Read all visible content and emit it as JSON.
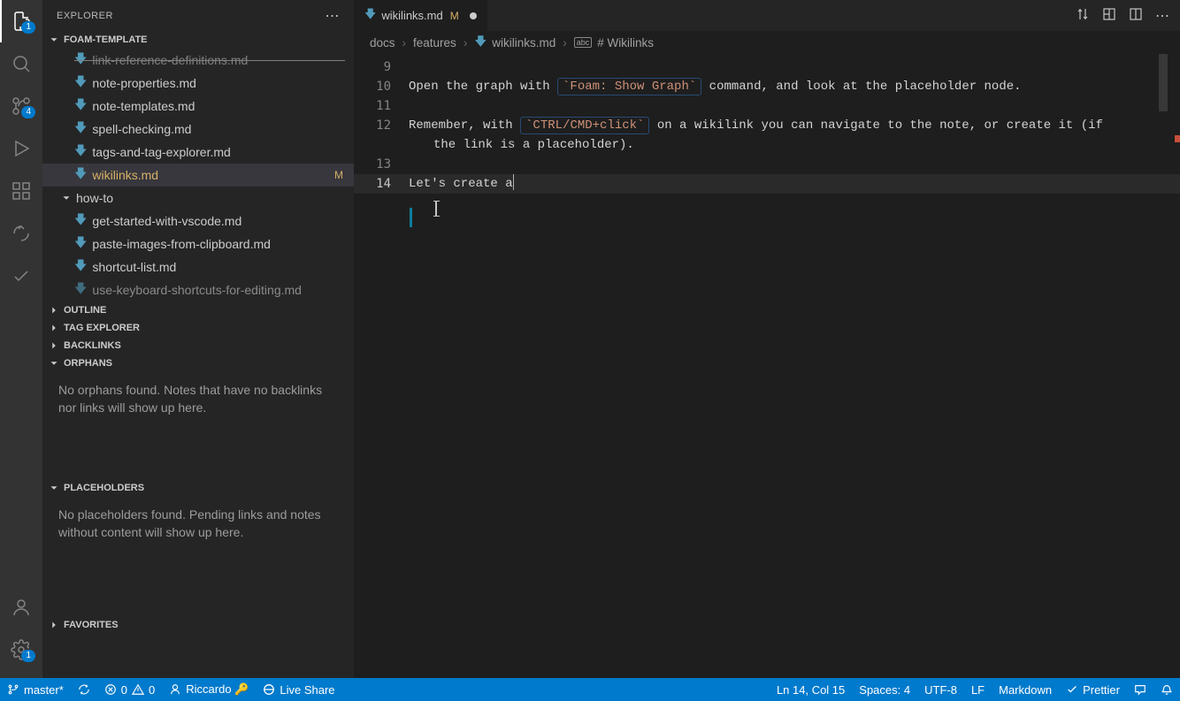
{
  "sidebar": {
    "title": "EXPLORER",
    "workspace": "FOAM-TEMPLATE",
    "tree": {
      "cut_item": "link-reference-definitions.md",
      "files_group1": [
        "note-properties.md",
        "note-templates.md",
        "spell-checking.md",
        "tags-and-tag-explorer.md"
      ],
      "active_file": "wikilinks.md",
      "active_badge": "M",
      "folder": "how-to",
      "files_group2": [
        "get-started-with-vscode.md",
        "paste-images-from-clipboard.md",
        "shortcut-list.md",
        "use-keyboard-shortcuts-for-editing.md"
      ]
    },
    "sections": {
      "outline": "OUTLINE",
      "tag_explorer": "TAG EXPLORER",
      "backlinks": "BACKLINKS",
      "orphans": "ORPHANS",
      "orphans_msg": "No orphans found. Notes that have no backlinks nor links will show up here.",
      "placeholders": "PLACEHOLDERS",
      "placeholders_msg": "No placeholders found. Pending links and notes without content will show up here.",
      "favorites": "FAVORITES"
    }
  },
  "activity": {
    "explorer_badge": "1",
    "scm_badge": "4",
    "settings_badge": "1"
  },
  "tab": {
    "name": "wikilinks.md",
    "modified": "M"
  },
  "breadcrumbs": {
    "p1": "docs",
    "p2": "features",
    "p3": "wikilinks.md",
    "p4": "# Wikilinks"
  },
  "editor": {
    "lines": {
      "n9": "9",
      "n10": "10",
      "l10a": "Open the graph with ",
      "l10tag": "`Foam: Show Graph`",
      "l10b": " command, and look at the placeholder node.",
      "n11": "11",
      "n12": "12",
      "l12a": "Remember, with ",
      "l12tag": "`CTRL/CMD+click`",
      "l12b": " on a wikilink you can navigate to the note, or create it (if ",
      "l12c": "the link is a placeholder).",
      "n13": "13",
      "n14": "14",
      "l14": "Let's create a"
    }
  },
  "status": {
    "branch": "master*",
    "sync": "",
    "errors": "0",
    "warnings": "0",
    "liveshare_user": "Riccardo 🔑",
    "liveshare": "Live Share",
    "position": "Ln 14, Col 15",
    "spaces": "Spaces: 4",
    "encoding": "UTF-8",
    "eol": "LF",
    "language": "Markdown",
    "prettier": "Prettier"
  }
}
